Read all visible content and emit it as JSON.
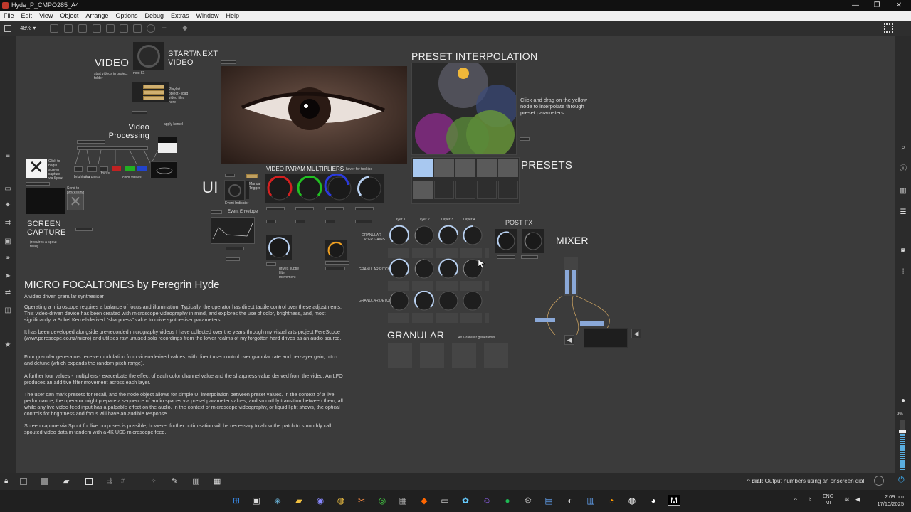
{
  "window": {
    "title": "Hyde_P_CMPO285_A4",
    "min": "—",
    "max": "❐",
    "close": "✕"
  },
  "menu": [
    "File",
    "Edit",
    "View",
    "Object",
    "Arrange",
    "Options",
    "Debug",
    "Extras",
    "Window",
    "Help"
  ],
  "toolbar": {
    "zoom": "48%"
  },
  "video": {
    "title": "VIDEO",
    "start_next": "START/NEXT VIDEO",
    "sub": "start videos in project folder",
    "playlist_note": "Playlist object - load video files here",
    "next_label": "next $1",
    "apply_kernel": "apply kernel"
  },
  "video_processing": {
    "title": "Video Processing",
    "labels": [
      "brightness",
      "sharpness",
      "focus",
      "color values"
    ]
  },
  "screen_capture": {
    "title": "SCREEN CAPTURE",
    "note": "(requires a spout feed)",
    "click_note": "Click to begin screen capture via Spout",
    "send_note": "Send to processing"
  },
  "ui_label": "UI",
  "video_param": {
    "title": "VIDEO PARAM MULTIPLIERS",
    "hover": "hover for tooltips"
  },
  "event": {
    "title": "Event Envelope",
    "indicator": "Event Indicator",
    "trigger": "Manual Trigger",
    "lfo_note": "drives subtle filter movement"
  },
  "preset_interp": {
    "title": "PRESET INTERPOLATION",
    "instructions": "Click and drag on the yellow node to interpolate through preset parameters"
  },
  "presets": {
    "title": "PRESETS"
  },
  "layers": [
    "Layer 1",
    "Layer 2",
    "Layer 3",
    "Layer 4"
  ],
  "granular": {
    "title": "GRANULAR",
    "layer_gains": "GRANULAR LAYER GAINS",
    "pitches": "GRANULAR PITCHES",
    "detune": "GRANULAR DETUNE",
    "note": "4x Granular generators"
  },
  "postfx": {
    "title": "POST FX"
  },
  "mixer": {
    "title": "MIXER"
  },
  "about": {
    "title": "MICRO FOCALTONES by Peregrin Hyde",
    "subtitle": "A video driven granular synthesiser",
    "p1": "Operating a microscope requires a balance of focus and illumination. Typically, the operator has direct tactile control over these adjustments. This video-driven device has been created with microscope videography in mind, and explores the use of color, brightness, and, most significantly, a Sobel Kernel-derived \"sharpness\" value to drive synthesiser parameters.",
    "p2": "It has been developed alongside pre-recorded micrography videos I have collected over the years through my visual arts project PereScope (www.perescope.co.nz/micro) and utilises raw unused solo recordings from the lower realms of my forgotten hard drives as an audio source.",
    "p3": "Four granular generators receive modulation from video-derived values, with direct user control over granular rate and per-layer gain, pitch and detune (which expands the random pitch range).",
    "p4": "A further four values - multipliers - exacerbate the effect of each color channel value and the sharpness value derived from the video. An LFO produces an additive filter movement across each layer.",
    "p5": "The user can mark presets for recall, and the node object allows for simple UI interpolation between preset values. In the context of a live performance, the operator might prepare a sequence of audio spaces via preset parameter values, and smoothly transition between them, all while any live video-feed input has a palpable effect on the audio. In the context of microscope videography, or liquid light shows, the optical controls for brightness and focus will have an audible response.",
    "p6": "Screen capture via Spout for live purposes is possible, however further optimisation will be necessary to allow the patch to smoothly call spouted video data in tandem with a 4K USB microscope feed."
  },
  "statusbar": {
    "hint_key": "dial:",
    "hint": "Output numbers using an onscreen dial"
  },
  "rightbar": {
    "volume": "9%"
  },
  "taskbar": {
    "lang1": "ENG",
    "lang2": "MI",
    "time": "2:09 pm",
    "date": "17/10/2025"
  },
  "colors": {
    "accent_yellow": "#f0b83a",
    "dial_red": "#d42020",
    "dial_green": "#22c022",
    "dial_blue": "#2a3ae0",
    "dial_light": "#b8d0f0",
    "preset_active": "#a8c8f0"
  }
}
